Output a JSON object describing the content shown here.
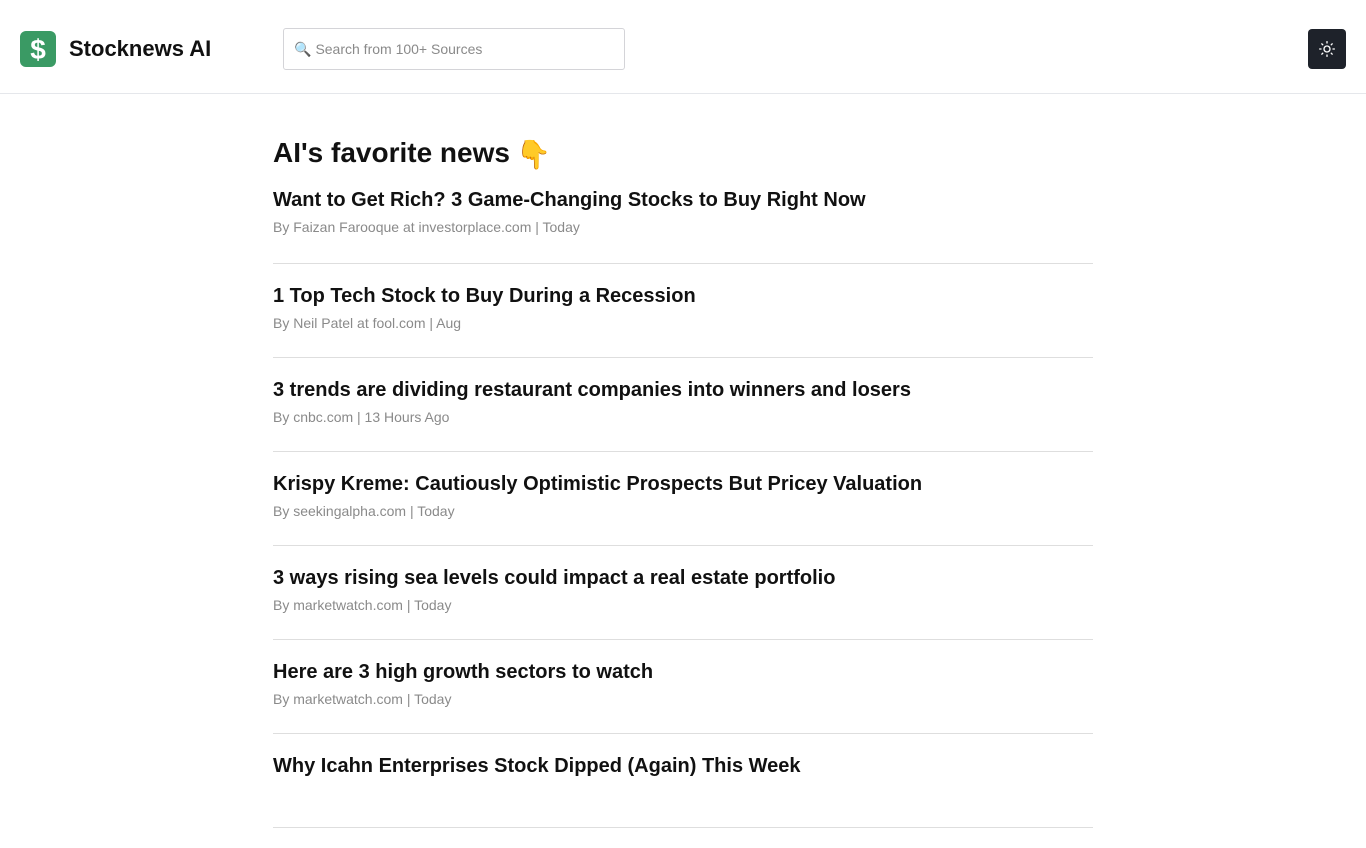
{
  "header": {
    "brand": "Stocknews AI",
    "search_placeholder": "Search from 100+ Sources",
    "theme_toggle_icon": "sun-icon"
  },
  "colors": {
    "accent": "#3a9a64",
    "dark_button": "#1e222a",
    "meta_text": "#8a8a8a"
  },
  "main": {
    "title": "AI's favorite news",
    "title_emoji": "👇",
    "news": [
      {
        "title": "Want to Get Rich? 3 Game-Changing Stocks to Buy Right Now",
        "meta": "By Faizan Farooque at investorplace.com | Today"
      },
      {
        "title": "1 Top Tech Stock to Buy During a Recession",
        "meta": "By Neil Patel at fool.com | Aug"
      },
      {
        "title": "3 trends are dividing restaurant companies into winners and losers",
        "meta": "By cnbc.com | 13 Hours Ago"
      },
      {
        "title": "Krispy Kreme: Cautiously Optimistic Prospects But Pricey Valuation",
        "meta": "By seekingalpha.com | Today"
      },
      {
        "title": "3 ways rising sea levels could impact a real estate portfolio",
        "meta": "By marketwatch.com | Today"
      },
      {
        "title": "Here are 3 high growth sectors to watch",
        "meta": "By marketwatch.com | Today"
      },
      {
        "title": "Why Icahn Enterprises Stock Dipped (Again) This Week",
        "meta": ""
      }
    ]
  }
}
